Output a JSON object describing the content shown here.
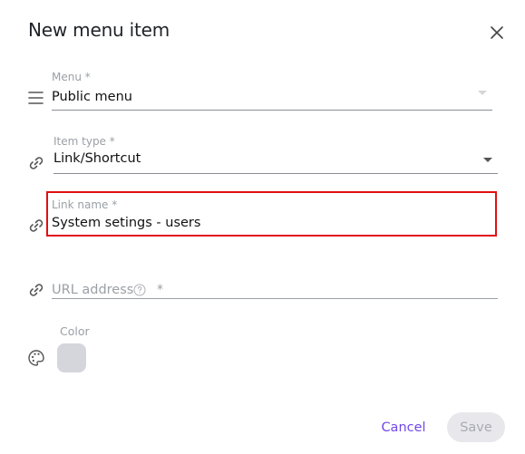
{
  "dialog": {
    "title": "New menu item"
  },
  "menu_field": {
    "label": "Menu *",
    "value": "Public menu"
  },
  "item_type_field": {
    "label": "Item type *",
    "value": "Link/Shortcut"
  },
  "link_name_field": {
    "label": "Link name *",
    "value": "System setings - users"
  },
  "url_field": {
    "placeholder": "URL address",
    "required_mark": "*"
  },
  "color_field": {
    "label": "Color",
    "swatch_color": "#d5d5dc"
  },
  "buttons": {
    "cancel_label": "Cancel",
    "save_label": "Save"
  },
  "colors": {
    "accent": "#7048e8",
    "highlight": "#e01010"
  },
  "icons": [
    "close-icon",
    "menu-lines-icon",
    "link-icon",
    "help-circle-icon",
    "palette-icon",
    "chevron-down-icon"
  ]
}
